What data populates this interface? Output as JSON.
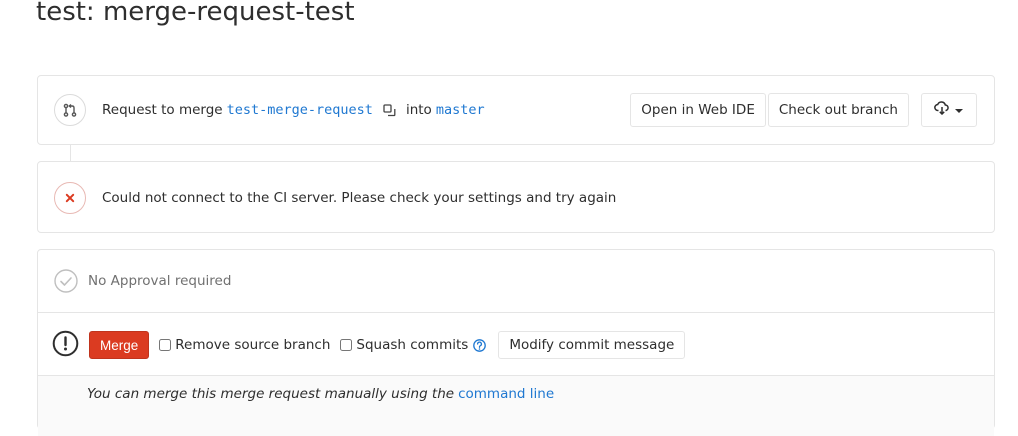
{
  "page": {
    "title": "test: merge-request-test"
  },
  "merge_request": {
    "request_label": "Request to merge",
    "source_branch": "test-merge-request",
    "into_label": "into",
    "target_branch": "master",
    "open_web_ide_label": "Open in Web IDE",
    "check_out_branch_label": "Check out branch",
    "download_icon": "cloud-download-icon",
    "icon": "merge-request-icon"
  },
  "ci": {
    "message": "Could not connect to the CI server. Please check your settings and try again",
    "icon": "status-failed-icon",
    "status_color": "#db3b21"
  },
  "approvals": {
    "message": "No Approval required",
    "icon": "approval-check-icon"
  },
  "merge": {
    "merge_label": "Merge",
    "merge_color": "#db3b21",
    "remove_source_branch_label": "Remove source branch",
    "remove_source_branch_checked": false,
    "squash_commits_label": "Squash commits",
    "squash_commits_checked": false,
    "modify_commit_message_label": "Modify commit message",
    "warning_icon": "exclamation-circle-icon",
    "help_icon": "question-circle-icon"
  },
  "manual": {
    "text": "You can merge this merge request manually using the",
    "link_text": "command line"
  },
  "colors": {
    "link": "#1f78d1",
    "border": "#e5e5e5"
  }
}
